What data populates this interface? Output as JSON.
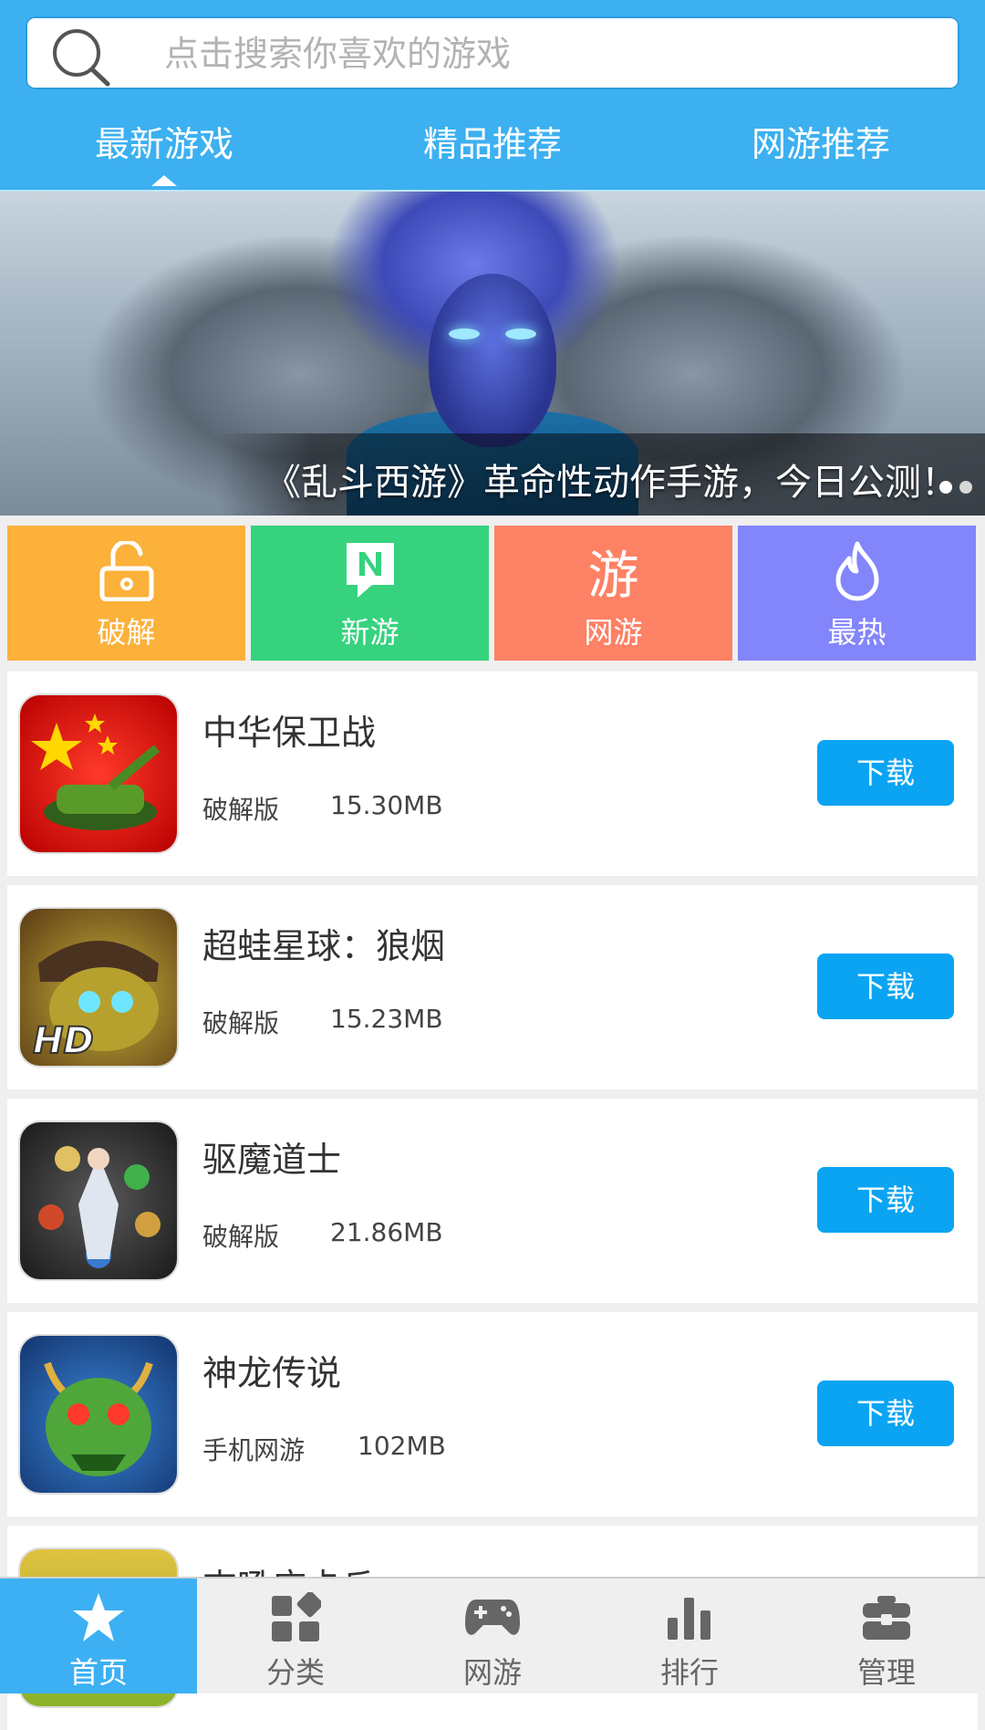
{
  "search": {
    "placeholder": "点击搜索你喜欢的游戏"
  },
  "tabs": [
    {
      "label": "最新游戏",
      "active": true
    },
    {
      "label": "精品推荐",
      "active": false
    },
    {
      "label": "网游推荐",
      "active": false
    }
  ],
  "banner": {
    "caption": "《乱斗西游》革命性动作手游，今日公测！",
    "slide_index": 1,
    "slide_count": 2
  },
  "categories": [
    {
      "label": "破解",
      "icon": "unlock-icon",
      "color": "#fbb13a"
    },
    {
      "label": "新游",
      "icon": "new-n-icon",
      "color": "#36d27e"
    },
    {
      "label": "网游",
      "icon_text": "游",
      "color": "#fd8164"
    },
    {
      "label": "最热",
      "icon": "flame-icon",
      "color": "#8385fb"
    }
  ],
  "games": [
    {
      "name": "中华保卫战",
      "type": "破解版",
      "size": "15.30MB",
      "download": "下载"
    },
    {
      "name": "超蛙星球：狼烟",
      "type": "破解版",
      "size": "15.23MB",
      "download": "下载"
    },
    {
      "name": "驱魔道士",
      "type": "破解版",
      "size": "21.86MB",
      "download": "下载"
    },
    {
      "name": "神龙传说",
      "type": "手机网游",
      "size": "102MB",
      "download": "下载"
    },
    {
      "name": "吉吼庄卡丘",
      "type": "",
      "size": "",
      "download": ""
    }
  ],
  "bottom_nav": [
    {
      "label": "首页",
      "icon": "star-icon",
      "active": true
    },
    {
      "label": "分类",
      "icon": "category-icon",
      "active": false
    },
    {
      "label": "网游",
      "icon": "gamepad-icon",
      "active": false
    },
    {
      "label": "排行",
      "icon": "bar-chart-icon",
      "active": false
    },
    {
      "label": "管理",
      "icon": "briefcase-icon",
      "active": false
    }
  ],
  "colors": {
    "primary": "#3cb0f0",
    "download_button": "#0aa4f2"
  }
}
